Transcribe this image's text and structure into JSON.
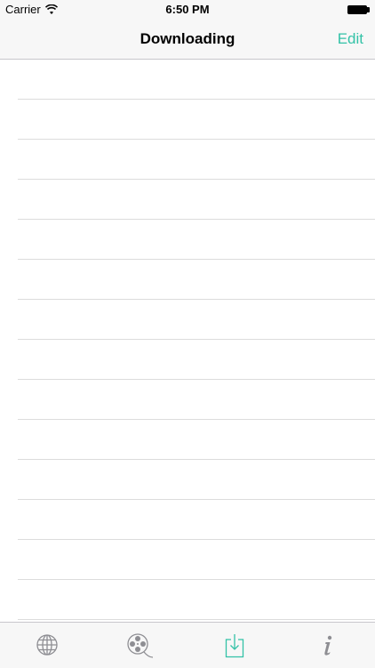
{
  "status_bar": {
    "carrier": "Carrier",
    "time": "6:50 PM",
    "icons": [
      "wifi-icon",
      "battery-icon"
    ]
  },
  "nav_bar": {
    "title": "Downloading",
    "edit_label": "Edit",
    "accent_color": "#33c2a7"
  },
  "list": {
    "rows": [
      "",
      "",
      "",
      "",
      "",
      "",
      "",
      "",
      "",
      "",
      "",
      "",
      "",
      "",
      ""
    ]
  },
  "tab_bar": {
    "tabs": [
      {
        "icon": "globe-icon",
        "active": false
      },
      {
        "icon": "film-reel-icon",
        "active": false
      },
      {
        "icon": "download-icon",
        "active": true
      },
      {
        "icon": "info-icon",
        "active": false
      }
    ],
    "active_color": "#33c2a7",
    "inactive_color": "#8e8e93"
  }
}
